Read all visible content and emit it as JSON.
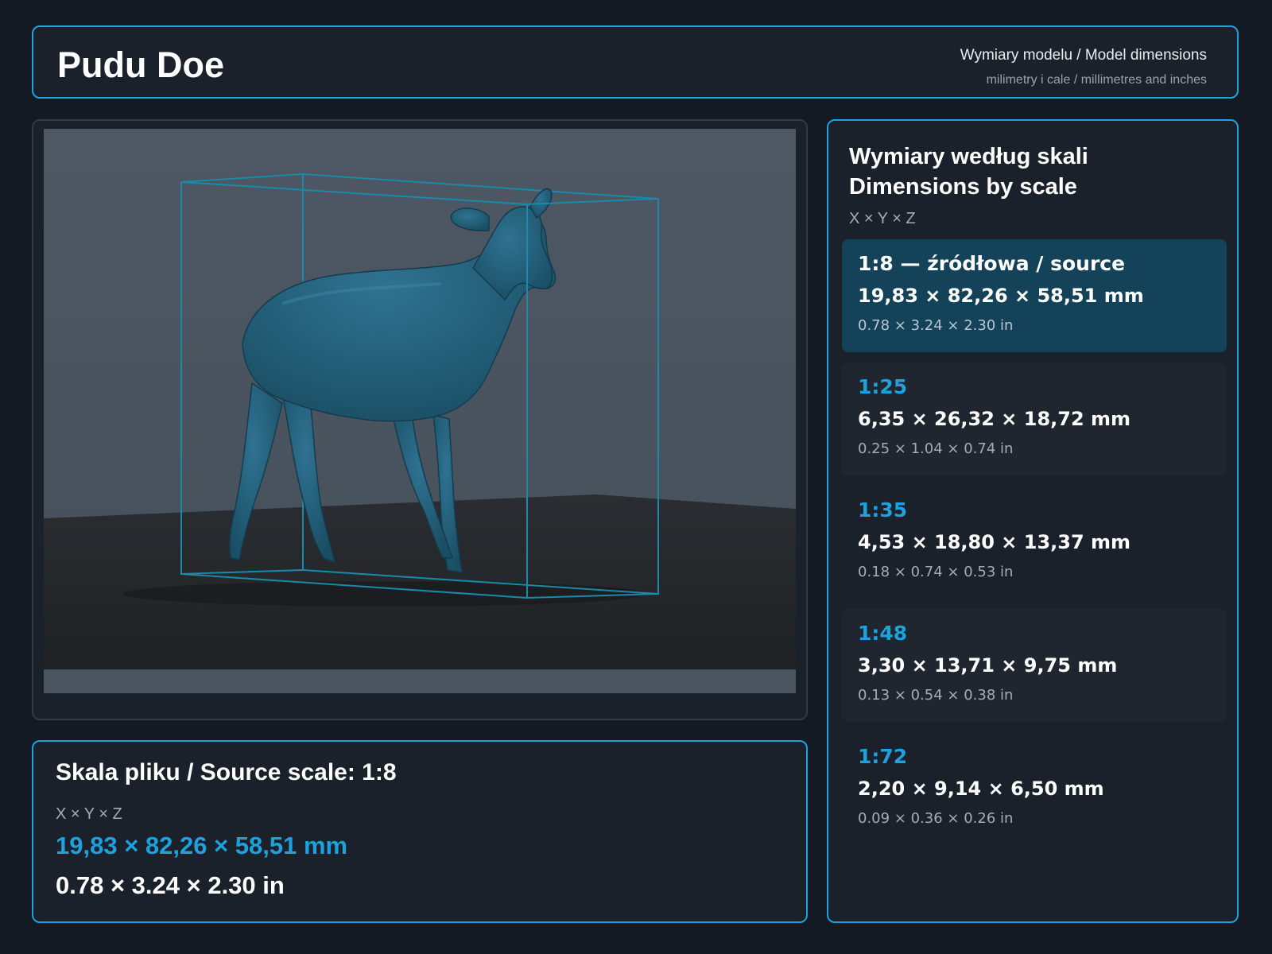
{
  "header": {
    "title": "Pudu Doe",
    "subtitle": "Wymiary modelu / Model dimensions",
    "units": "milimetry i cale / millimetres and inches"
  },
  "viewer": {
    "model": "pudu-doe-3d-model",
    "colors": {
      "model": "#1f5a73",
      "bounding_box": "#1a8aa8",
      "background": "#4b5561",
      "floor": "#232629"
    }
  },
  "source": {
    "title": "Skala pliku / Source scale: 1:8",
    "axes": "X × Y × Z",
    "mm": "19,83 × 82,26 × 58,51 mm",
    "in": "0.78 × 3.24 × 2.30 in"
  },
  "scales": {
    "title_pl": "Wymiary według skali",
    "title_en": "Dimensions by scale",
    "axes": "X × Y × Z",
    "items": [
      {
        "ratio": "1:8  —  źródłowa / source",
        "mm": "19,83 × 82,26 × 58,51 mm",
        "in": "0.78 × 3.24 × 2.30 in",
        "active": true
      },
      {
        "ratio": "1:25",
        "mm": "6,35 × 26,32 × 18,72 mm",
        "in": "0.25 × 1.04 × 0.74 in",
        "active": false
      },
      {
        "ratio": "1:35",
        "mm": "4,53 × 18,80 × 13,37 mm",
        "in": "0.18 × 0.74 × 0.53 in",
        "active": false
      },
      {
        "ratio": "1:48",
        "mm": "3,30 × 13,71 × 9,75 mm",
        "in": "0.13 × 0.54 × 0.38 in",
        "active": false
      },
      {
        "ratio": "1:72",
        "mm": "2,20 × 9,14 × 6,50 mm",
        "in": "0.09 × 0.36 × 0.26 in",
        "active": false
      }
    ]
  },
  "accent_color": "#1ea1dc"
}
